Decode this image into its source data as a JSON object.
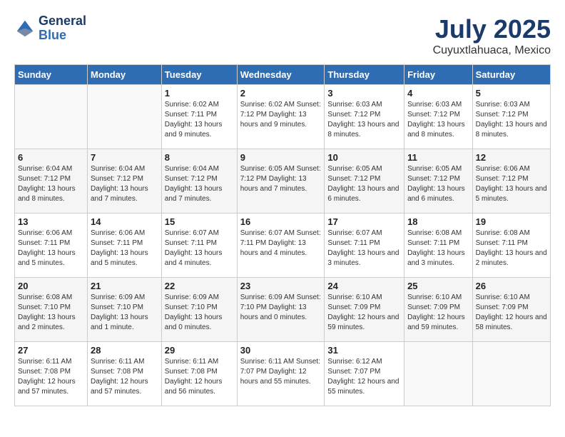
{
  "header": {
    "logo_line1": "General",
    "logo_line2": "Blue",
    "month": "July 2025",
    "location": "Cuyuxtlahuaca, Mexico"
  },
  "days_of_week": [
    "Sunday",
    "Monday",
    "Tuesday",
    "Wednesday",
    "Thursday",
    "Friday",
    "Saturday"
  ],
  "weeks": [
    [
      {
        "day": "",
        "detail": ""
      },
      {
        "day": "",
        "detail": ""
      },
      {
        "day": "1",
        "detail": "Sunrise: 6:02 AM\nSunset: 7:11 PM\nDaylight: 13 hours\nand 9 minutes."
      },
      {
        "day": "2",
        "detail": "Sunrise: 6:02 AM\nSunset: 7:12 PM\nDaylight: 13 hours\nand 9 minutes."
      },
      {
        "day": "3",
        "detail": "Sunrise: 6:03 AM\nSunset: 7:12 PM\nDaylight: 13 hours\nand 8 minutes."
      },
      {
        "day": "4",
        "detail": "Sunrise: 6:03 AM\nSunset: 7:12 PM\nDaylight: 13 hours\nand 8 minutes."
      },
      {
        "day": "5",
        "detail": "Sunrise: 6:03 AM\nSunset: 7:12 PM\nDaylight: 13 hours\nand 8 minutes."
      }
    ],
    [
      {
        "day": "6",
        "detail": "Sunrise: 6:04 AM\nSunset: 7:12 PM\nDaylight: 13 hours\nand 8 minutes."
      },
      {
        "day": "7",
        "detail": "Sunrise: 6:04 AM\nSunset: 7:12 PM\nDaylight: 13 hours\nand 7 minutes."
      },
      {
        "day": "8",
        "detail": "Sunrise: 6:04 AM\nSunset: 7:12 PM\nDaylight: 13 hours\nand 7 minutes."
      },
      {
        "day": "9",
        "detail": "Sunrise: 6:05 AM\nSunset: 7:12 PM\nDaylight: 13 hours\nand 7 minutes."
      },
      {
        "day": "10",
        "detail": "Sunrise: 6:05 AM\nSunset: 7:12 PM\nDaylight: 13 hours\nand 6 minutes."
      },
      {
        "day": "11",
        "detail": "Sunrise: 6:05 AM\nSunset: 7:12 PM\nDaylight: 13 hours\nand 6 minutes."
      },
      {
        "day": "12",
        "detail": "Sunrise: 6:06 AM\nSunset: 7:12 PM\nDaylight: 13 hours\nand 5 minutes."
      }
    ],
    [
      {
        "day": "13",
        "detail": "Sunrise: 6:06 AM\nSunset: 7:11 PM\nDaylight: 13 hours\nand 5 minutes."
      },
      {
        "day": "14",
        "detail": "Sunrise: 6:06 AM\nSunset: 7:11 PM\nDaylight: 13 hours\nand 5 minutes."
      },
      {
        "day": "15",
        "detail": "Sunrise: 6:07 AM\nSunset: 7:11 PM\nDaylight: 13 hours\nand 4 minutes."
      },
      {
        "day": "16",
        "detail": "Sunrise: 6:07 AM\nSunset: 7:11 PM\nDaylight: 13 hours\nand 4 minutes."
      },
      {
        "day": "17",
        "detail": "Sunrise: 6:07 AM\nSunset: 7:11 PM\nDaylight: 13 hours\nand 3 minutes."
      },
      {
        "day": "18",
        "detail": "Sunrise: 6:08 AM\nSunset: 7:11 PM\nDaylight: 13 hours\nand 3 minutes."
      },
      {
        "day": "19",
        "detail": "Sunrise: 6:08 AM\nSunset: 7:11 PM\nDaylight: 13 hours\nand 2 minutes."
      }
    ],
    [
      {
        "day": "20",
        "detail": "Sunrise: 6:08 AM\nSunset: 7:10 PM\nDaylight: 13 hours\nand 2 minutes."
      },
      {
        "day": "21",
        "detail": "Sunrise: 6:09 AM\nSunset: 7:10 PM\nDaylight: 13 hours\nand 1 minute."
      },
      {
        "day": "22",
        "detail": "Sunrise: 6:09 AM\nSunset: 7:10 PM\nDaylight: 13 hours\nand 0 minutes."
      },
      {
        "day": "23",
        "detail": "Sunrise: 6:09 AM\nSunset: 7:10 PM\nDaylight: 13 hours\nand 0 minutes."
      },
      {
        "day": "24",
        "detail": "Sunrise: 6:10 AM\nSunset: 7:09 PM\nDaylight: 12 hours\nand 59 minutes."
      },
      {
        "day": "25",
        "detail": "Sunrise: 6:10 AM\nSunset: 7:09 PM\nDaylight: 12 hours\nand 59 minutes."
      },
      {
        "day": "26",
        "detail": "Sunrise: 6:10 AM\nSunset: 7:09 PM\nDaylight: 12 hours\nand 58 minutes."
      }
    ],
    [
      {
        "day": "27",
        "detail": "Sunrise: 6:11 AM\nSunset: 7:08 PM\nDaylight: 12 hours\nand 57 minutes."
      },
      {
        "day": "28",
        "detail": "Sunrise: 6:11 AM\nSunset: 7:08 PM\nDaylight: 12 hours\nand 57 minutes."
      },
      {
        "day": "29",
        "detail": "Sunrise: 6:11 AM\nSunset: 7:08 PM\nDaylight: 12 hours\nand 56 minutes."
      },
      {
        "day": "30",
        "detail": "Sunrise: 6:11 AM\nSunset: 7:07 PM\nDaylight: 12 hours\nand 55 minutes."
      },
      {
        "day": "31",
        "detail": "Sunrise: 6:12 AM\nSunset: 7:07 PM\nDaylight: 12 hours\nand 55 minutes."
      },
      {
        "day": "",
        "detail": ""
      },
      {
        "day": "",
        "detail": ""
      }
    ]
  ]
}
